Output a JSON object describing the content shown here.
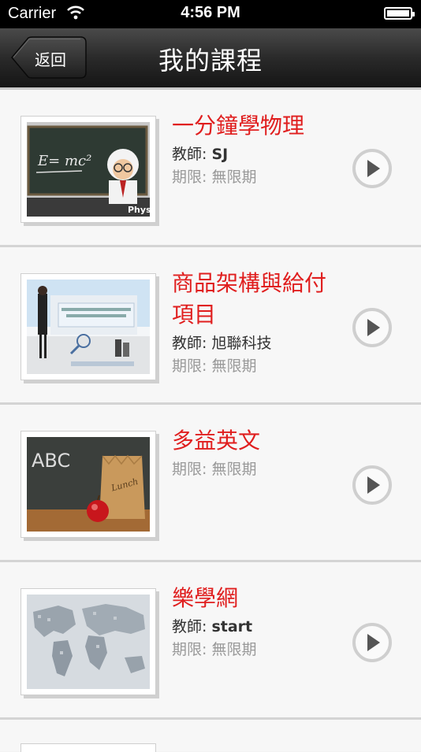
{
  "status": {
    "carrier": "Carrier",
    "time": "4:56 PM"
  },
  "nav": {
    "back": "返回",
    "title": "我的課程"
  },
  "courses": [
    {
      "title": "一分鐘學物理",
      "teacher_label": "教師:",
      "teacher": "SJ",
      "period_label": "期限:",
      "period": "無限期",
      "thumb": "physics-chalkboard"
    },
    {
      "title": "商品架構與給付項目",
      "teacher_label": "教師:",
      "teacher": "旭聯科技",
      "period_label": "期限:",
      "period": "無限期",
      "thumb": "presenter-slide"
    },
    {
      "title": "多益英文",
      "teacher_label": "",
      "teacher": "",
      "period_label": "期限:",
      "period": "無限期",
      "thumb": "abc-lunch-bag"
    },
    {
      "title": "樂學網",
      "teacher_label": "教師:",
      "teacher": "start",
      "period_label": "期限:",
      "period": "無限期",
      "thumb": "world-map"
    }
  ]
}
